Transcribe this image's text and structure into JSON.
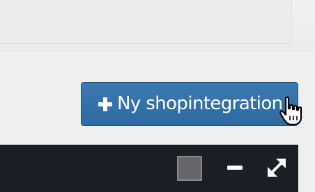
{
  "toolbar_button": {
    "label": "Ny shopintegration",
    "icon": "plus-icon",
    "color": "#3471aa"
  },
  "cursor": {
    "icon": "hand-pointer-icon"
  },
  "panel_toolbar": {
    "background": "#1b1e25",
    "color_swatch": "#666669",
    "minimize_icon": "minus-icon",
    "expand_icon": "expand-arrows-icon"
  }
}
